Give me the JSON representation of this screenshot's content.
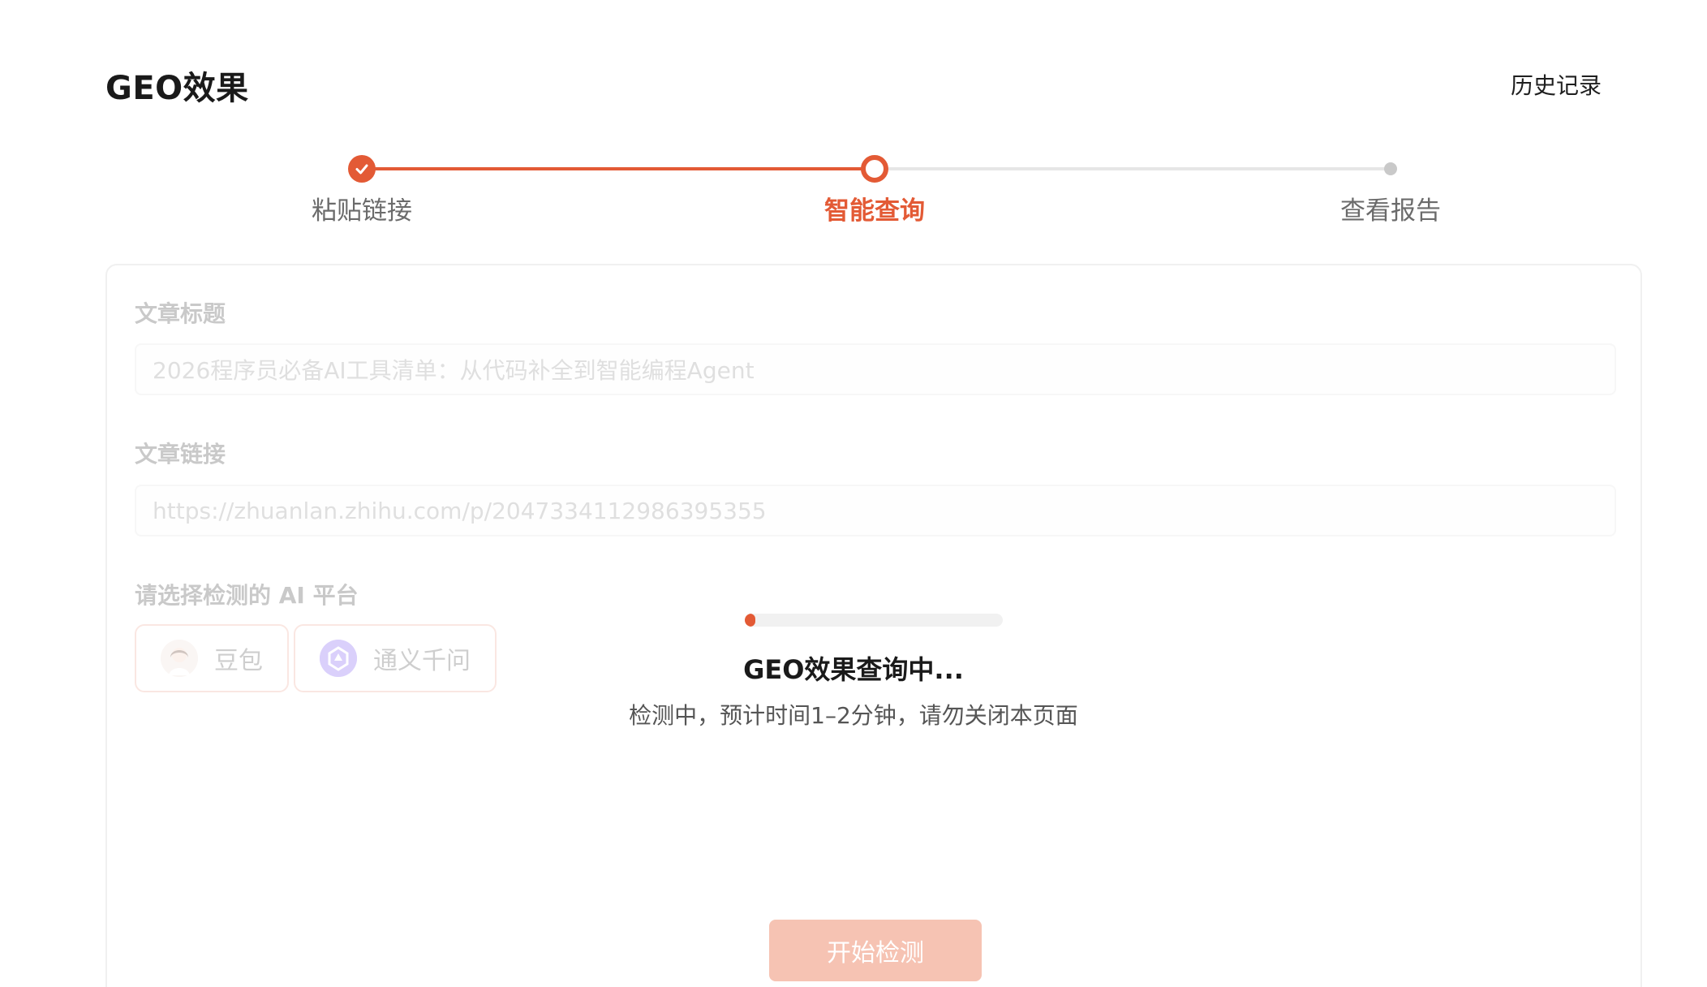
{
  "header": {
    "title": "GEO效果",
    "history_label": "历史记录"
  },
  "stepper": {
    "steps": [
      {
        "label": "粘贴链接",
        "status": "done"
      },
      {
        "label": "智能查询",
        "status": "current"
      },
      {
        "label": "查看报告",
        "status": "todo"
      }
    ]
  },
  "form": {
    "title_label": "文章标题",
    "title_value": "2026程序员必备AI工具清单：从代码补全到智能编程Agent",
    "link_label": "文章链接",
    "link_value": "https://zhuanlan.zhihu.com/p/2047334112986395355",
    "platform_label": "请选择检测的 AI 平台",
    "platforms": [
      {
        "label": "豆包",
        "icon": "doubao-avatar-icon"
      },
      {
        "label": "通义千问",
        "icon": "qwen-logo-icon"
      }
    ],
    "start_button": "开始检测"
  },
  "loading": {
    "progress": 0.03,
    "title": "GEO效果查询中...",
    "subtitle": "检测中，预计时间1–2分钟，请勿关闭本页面"
  },
  "colors": {
    "accent": "#e35a35",
    "inactive": "#c9c9c9"
  }
}
